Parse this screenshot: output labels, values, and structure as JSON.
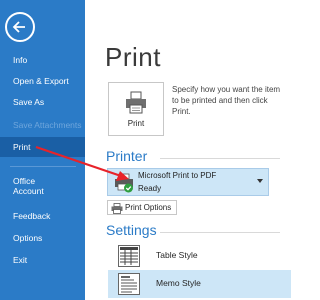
{
  "sidebar": {
    "items": [
      {
        "label": "Info"
      },
      {
        "label": "Open & Export"
      },
      {
        "label": "Save As"
      },
      {
        "label": "Save Attachments"
      },
      {
        "label": "Print"
      },
      {
        "label": "Office\nAccount"
      },
      {
        "label": "Feedback"
      },
      {
        "label": "Options"
      },
      {
        "label": "Exit"
      }
    ],
    "selected": "Print",
    "color": "#2b7bc7"
  },
  "main": {
    "title": "Print",
    "print_button": {
      "label": "Print"
    },
    "description": "Specify how you want the item to be printed and then click Print.",
    "printer": {
      "heading": "Printer",
      "name": "Microsoft Print to PDF",
      "status": "Ready",
      "options_label": "Print Options"
    },
    "settings": {
      "heading": "Settings",
      "styles": [
        {
          "label": "Table Style",
          "selected": false
        },
        {
          "label": "Memo Style",
          "selected": true
        }
      ]
    }
  },
  "annotation": {
    "color": "#e8232a"
  }
}
